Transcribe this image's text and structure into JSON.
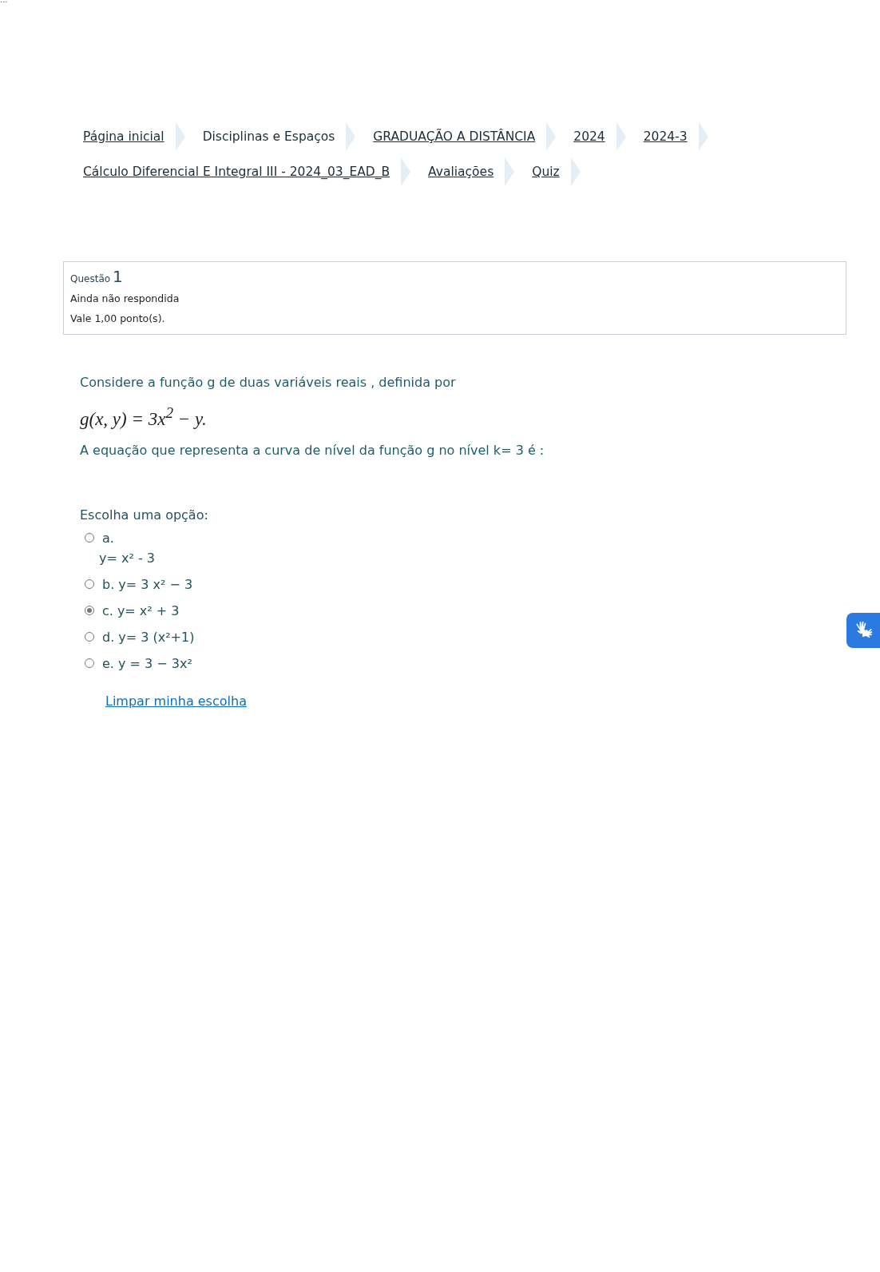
{
  "corner_mark": "...",
  "breadcrumb": [
    {
      "label": "Página inicial",
      "link": true
    },
    {
      "label": "Disciplinas e Espaços",
      "link": false
    },
    {
      "label": "GRADUAÇÃO A DISTÂNCIA",
      "link": true
    },
    {
      "label": "2024",
      "link": true
    },
    {
      "label": "2024-3",
      "link": true
    },
    {
      "label": "Cálculo Diferencial E Integral III - 2024_03_EAD_B",
      "link": true
    },
    {
      "label": "Avaliações",
      "link": true
    },
    {
      "label": "Quiz",
      "link": true
    }
  ],
  "question_info": {
    "title": "Questão",
    "number": "1",
    "state": "Ainda não respondida",
    "grade": "Vale 1,00 ponto(s)."
  },
  "question": {
    "intro": "Considere a função g de duas variáveis reais , definida por",
    "formula": "g(x, y) = 3x$^{2}$ − y.",
    "prompt": "A equação que representa a curva de nível da função g no nível k= 3 é :"
  },
  "answer": {
    "prompt": "Escolha uma opção:",
    "options": [
      {
        "letter": "a.",
        "text": "y= x² - 3",
        "kind": "stacked",
        "selected": false
      },
      {
        "letter": "b.",
        "text": "y= 3 x² − 3",
        "kind": "inline",
        "selected": false
      },
      {
        "letter": "c.",
        "text": "y= x² + 3",
        "kind": "inline",
        "selected": true
      },
      {
        "letter": "d.",
        "text": "y= 3 (x²+1)",
        "kind": "inline",
        "selected": false
      },
      {
        "letter": "e.",
        "text": "y = 3 − 3x²",
        "kind": "inline",
        "selected": false
      }
    ],
    "clear_link": "Limpar minha escolha"
  }
}
